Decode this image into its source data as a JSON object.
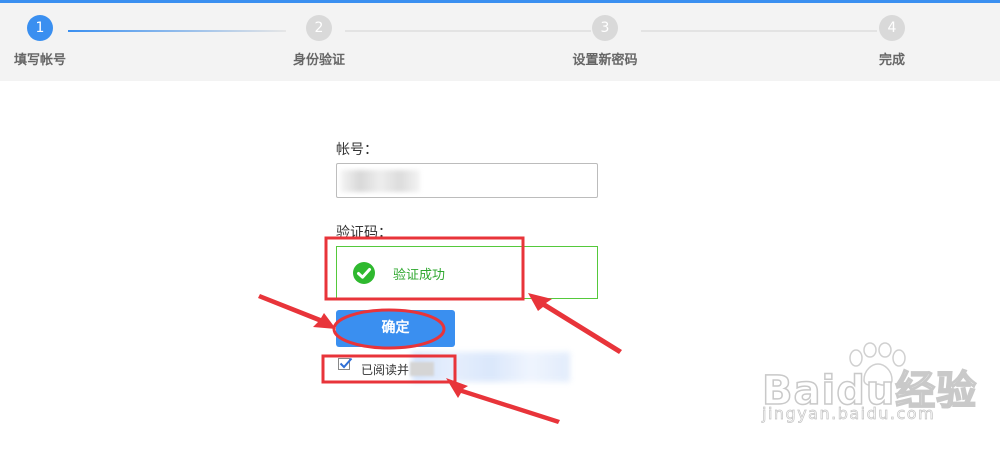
{
  "steps": [
    {
      "number": "1",
      "label": "填写帐号"
    },
    {
      "number": "2",
      "label": "身份验证"
    },
    {
      "number": "3",
      "label": "设置新密码"
    },
    {
      "number": "4",
      "label": "完成"
    }
  ],
  "current_step": 1,
  "form": {
    "account_label": "帐号：",
    "captcha_label": "验证码：",
    "captcha_status": "验证成功",
    "confirm_button": "确定",
    "agree_text": "已阅读并"
  },
  "colors": {
    "accent": "#3a8ff0",
    "success": "#2fb92f",
    "annotation": "#e8343a"
  },
  "watermark": {
    "brand": "Baidu经验",
    "url": "jingyan.baidu.com"
  }
}
